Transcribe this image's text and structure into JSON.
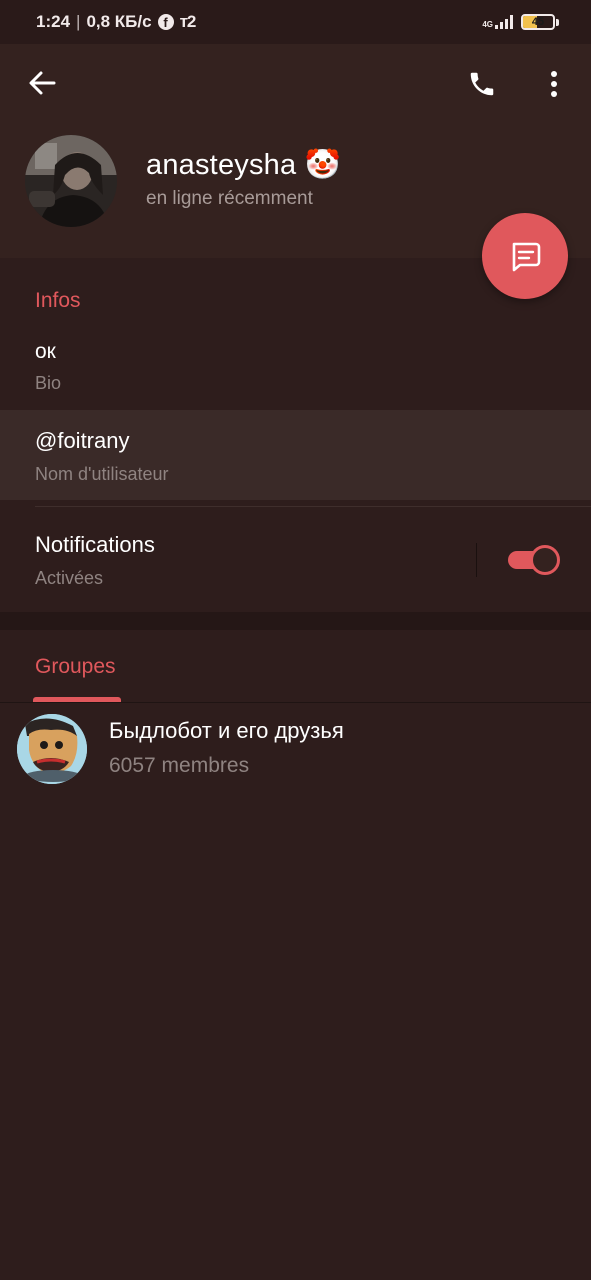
{
  "status_bar": {
    "time": "1:24",
    "separator": "|",
    "speed": "0,8 КБ/с",
    "facebook_icon": "f",
    "carrier_icon": "т2",
    "network": "4G",
    "battery": "45",
    "battery_level_percent": 45
  },
  "header": {
    "back_icon": "arrow-left-icon",
    "call_icon": "phone-icon",
    "more_icon": "more-vertical-icon",
    "name": "anasteysha",
    "name_emoji": "🤡",
    "status": "en ligne récemment",
    "message_icon": "message-icon"
  },
  "info": {
    "title": "Infos",
    "bio_value": "ок",
    "bio_label": "Bio",
    "username_value": "@foitrany",
    "username_label": "Nom d'utilisateur",
    "notifications_label": "Notifications",
    "notifications_state": "Activées",
    "notifications_enabled": true
  },
  "groups": {
    "tab_label": "Groupes",
    "items": [
      {
        "name": "Быдлобот и его друзья",
        "members": "6057 membres"
      }
    ]
  },
  "colors": {
    "accent": "#e0585c",
    "background": "#2e1d1c",
    "header_bg": "#34221f",
    "secondary_text": "#8f8381"
  }
}
